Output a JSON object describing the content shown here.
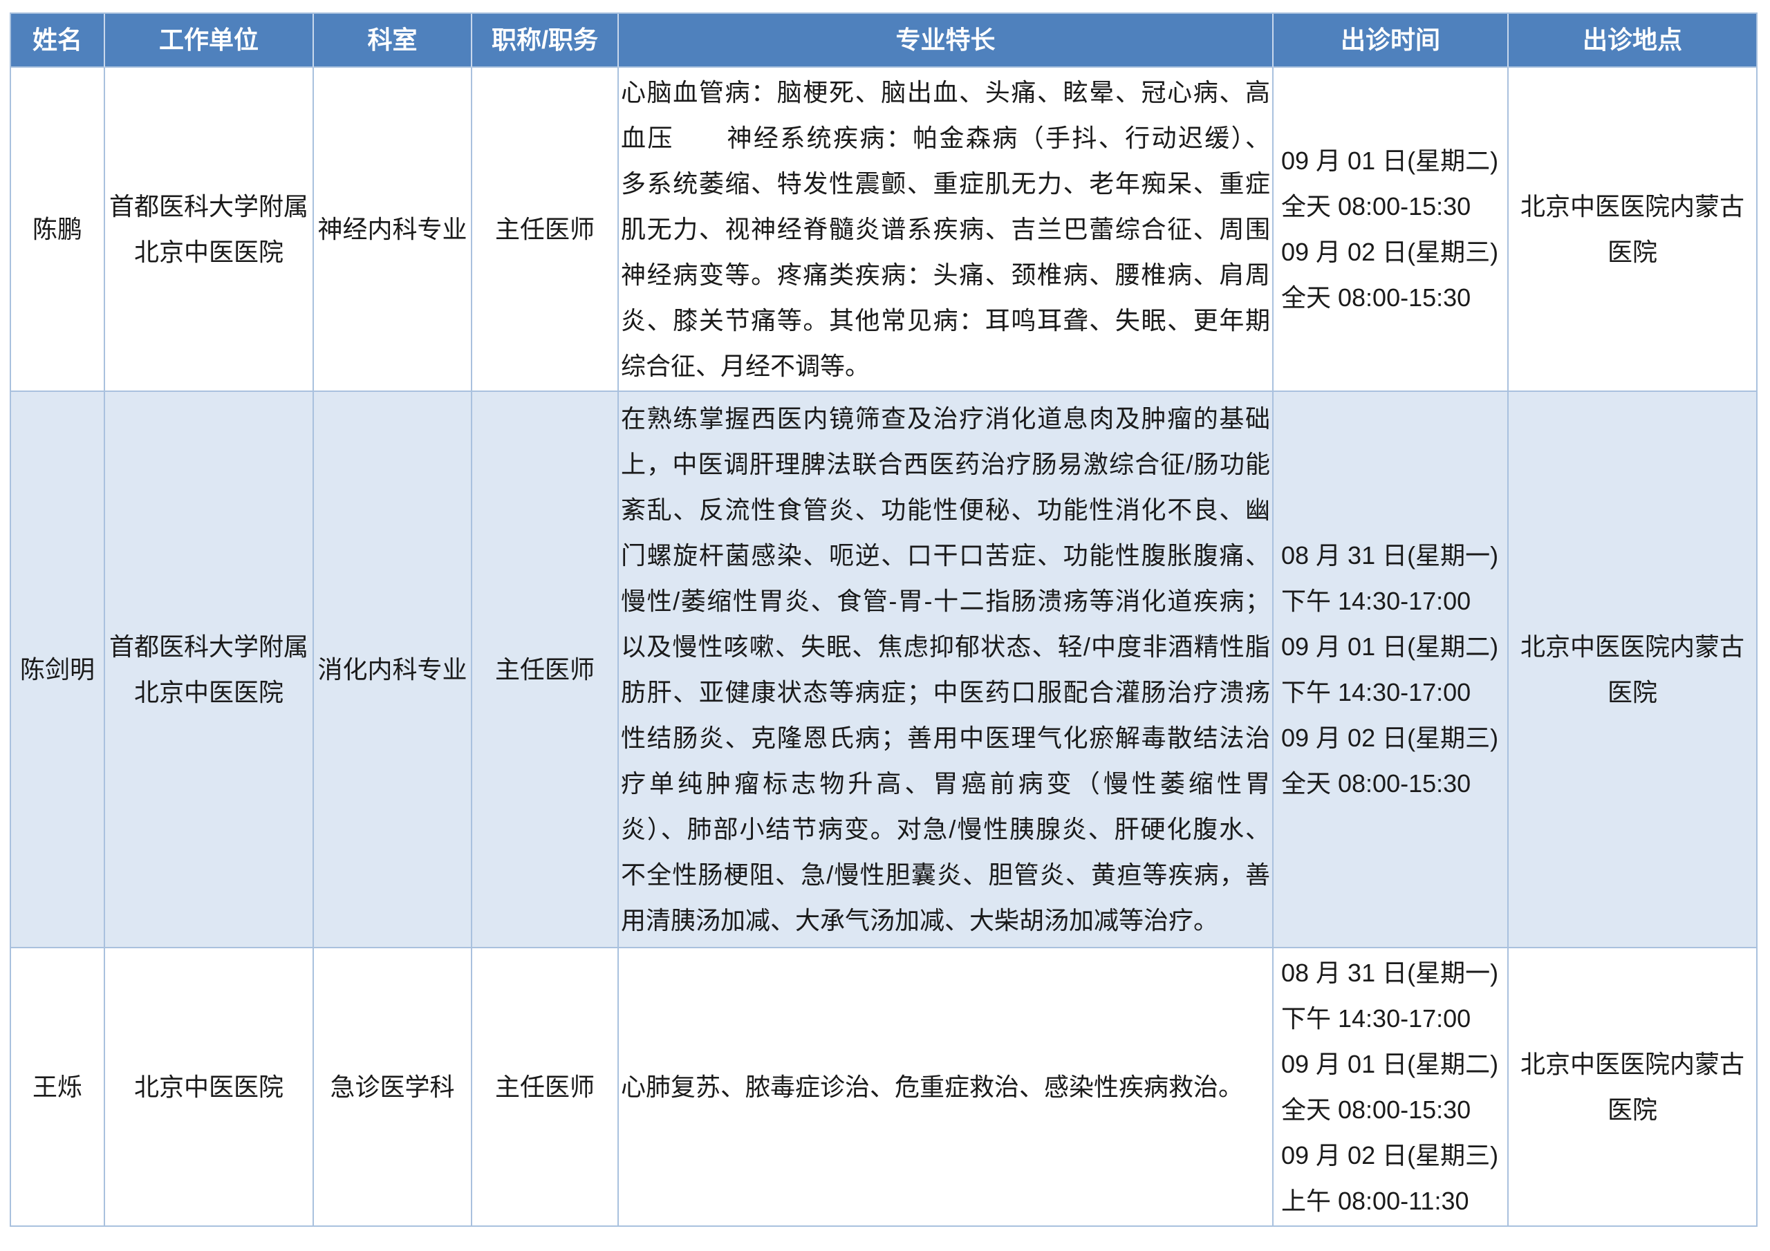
{
  "colors": {
    "header_bg": "#4F81BD",
    "header_text": "#FFFFFF",
    "alt_row_bg": "#DDE7F3",
    "grid_line": "#A9C1DE"
  },
  "table": {
    "headers": [
      "姓名",
      "工作单位",
      "科室",
      "职称/职务",
      "专业特长",
      "出诊时间",
      "出诊地点"
    ],
    "rows": [
      {
        "name": "陈鹏",
        "work_unit_lines": [
          "首都医科大学附属",
          "北京中医医院"
        ],
        "department": "神经内科专业",
        "title": "主任医师",
        "specialty_lines": [
          "心脑血管病：脑梗死、脑出血、头痛、眩晕、冠心病、高",
          "血压　　神经系统疾病：帕金森病（手抖、行动迟缓）、",
          "多系统萎缩、特发性震颤、重症肌无力、老年痴呆、重症",
          "肌无力、视神经脊髓炎谱系疾病、吉兰巴蕾综合征、周围",
          "神经病变等。疼痛类疾病：头痛、颈椎病、腰椎病、肩周",
          "炎、膝关节痛等。其他常见病：耳鸣耳聋、失眠、更年期",
          "综合征、月经不调等。"
        ],
        "schedule_lines": [
          "09 月 01 日(星期二)",
          "全天 08:00-15:30",
          "09 月 02 日(星期三)",
          "全天 08:00-15:30"
        ],
        "location_lines": [
          "北京中医医院内蒙古",
          "医院"
        ]
      },
      {
        "name": "陈剑明",
        "work_unit_lines": [
          "首都医科大学附属",
          "北京中医医院"
        ],
        "department": "消化内科专业",
        "title": "主任医师",
        "specialty_lines": [
          "在熟练掌握西医内镜筛查及治疗消化道息肉及肿瘤的基础",
          "上，中医调肝理脾法联合西医药治疗肠易激综合征/肠功能",
          "紊乱、反流性食管炎、功能性便秘、功能性消化不良、幽",
          "门螺旋杆菌感染、呃逆、口干口苦症、功能性腹胀腹痛、",
          "慢性/萎缩性胃炎、食管-胃-十二指肠溃疡等消化道疾病；",
          "以及慢性咳嗽、失眠、焦虑抑郁状态、轻/中度非酒精性脂",
          "肪肝、亚健康状态等病症；中医药口服配合灌肠治疗溃疡",
          "性结肠炎、克隆恩氏病；善用中医理气化瘀解毒散结法治",
          "疗单纯肿瘤标志物升高、胃癌前病变（慢性萎缩性胃",
          "炎）、肺部小结节病变。对急/慢性胰腺炎、肝硬化腹水、",
          "不全性肠梗阻、急/慢性胆囊炎、胆管炎、黄疸等疾病，善",
          "用清胰汤加减、大承气汤加减、大柴胡汤加减等治疗。"
        ],
        "schedule_lines": [
          "08 月 31 日(星期一)",
          "下午 14:30-17:00",
          "09 月 01 日(星期二)",
          "下午 14:30-17:00",
          "09 月 02 日(星期三)",
          "全天 08:00-15:30"
        ],
        "location_lines": [
          "北京中医医院内蒙古",
          "医院"
        ]
      },
      {
        "name": "王烁",
        "work_unit_lines": [
          "北京中医医院"
        ],
        "department": "急诊医学科",
        "title": "主任医师",
        "specialty_lines": [
          "心肺复苏、脓毒症诊治、危重症救治、感染性疾病救治。"
        ],
        "schedule_lines": [
          "08 月 31 日(星期一)",
          "下午 14:30-17:00",
          "09 月 01 日(星期二)",
          "全天 08:00-15:30",
          "09 月 02 日(星期三)",
          "上午 08:00-11:30"
        ],
        "location_lines": [
          "北京中医医院内蒙古",
          "医院"
        ]
      }
    ]
  }
}
